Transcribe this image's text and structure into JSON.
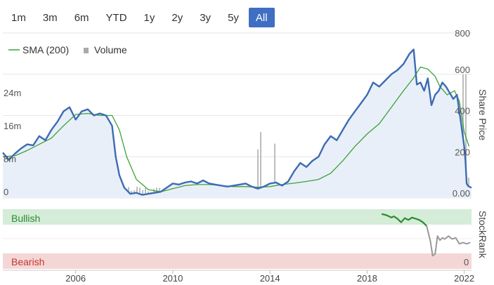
{
  "range_buttons": [
    {
      "label": "1m",
      "active": false
    },
    {
      "label": "3m",
      "active": false
    },
    {
      "label": "6m",
      "active": false
    },
    {
      "label": "YTD",
      "active": false
    },
    {
      "label": "1y",
      "active": false
    },
    {
      "label": "2y",
      "active": false
    },
    {
      "label": "3y",
      "active": false
    },
    {
      "label": "5y",
      "active": false
    },
    {
      "label": "All",
      "active": true
    }
  ],
  "legend": {
    "sma_label": "SMA (200)",
    "volume_label": "Volume"
  },
  "colors": {
    "price": "#3d6bb3",
    "price_fill": "#e9eff8",
    "sma": "#3aa23a",
    "volume": "#bdbdbd",
    "bullish_band": "#d4ecd8",
    "bearish_band": "#f5d6d6",
    "stockrank_bull": "#2e8b2e",
    "stockrank_grey": "#999999",
    "active_button": "#3e6fc2"
  },
  "chart_data": [
    {
      "type": "line",
      "name": "share-price-chart",
      "x_range": [
        2003.0,
        2022.3
      ],
      "x_ticks": [
        "2006",
        "2010",
        "2014",
        "2018",
        "2022"
      ],
      "x_tick_values": [
        2006,
        2010,
        2014,
        2018,
        2022
      ],
      "y_right_label": "Share Price",
      "y_right_ticks": [
        "800",
        "600",
        "400",
        "200",
        "0.00"
      ],
      "y_right_tick_values": [
        800,
        600,
        400,
        200,
        0
      ],
      "y_right_range": [
        0,
        800
      ],
      "y_left_ticks": [
        "24m",
        "16m",
        "8m",
        "0"
      ],
      "y_left_tick_values": [
        24,
        16,
        8,
        0
      ],
      "y_left_range": [
        0,
        40
      ],
      "series": [
        {
          "name": "SMA (200)",
          "x": [
            2003.0,
            2003.5,
            2004.0,
            2004.5,
            2005.0,
            2005.5,
            2006.0,
            2006.5,
            2007.0,
            2007.5,
            2007.8,
            2008.1,
            2008.5,
            2009.0,
            2009.5,
            2010.0,
            2010.5,
            2011.0,
            2011.5,
            2012.0,
            2012.5,
            2013.0,
            2013.5,
            2014.0,
            2014.5,
            2015.0,
            2015.5,
            2016.0,
            2016.5,
            2017.0,
            2017.5,
            2018.0,
            2018.5,
            2019.0,
            2019.5,
            2019.9,
            2020.2,
            2020.5,
            2020.8,
            2021.0,
            2021.3,
            2021.6,
            2021.8,
            2022.0,
            2022.2
          ],
          "y": [
            200,
            205,
            230,
            260,
            290,
            350,
            405,
            410,
            400,
            400,
            330,
            200,
            90,
            40,
            30,
            45,
            60,
            65,
            65,
            60,
            55,
            55,
            52,
            55,
            65,
            72,
            80,
            90,
            120,
            180,
            250,
            310,
            360,
            440,
            520,
            580,
            635,
            625,
            590,
            540,
            500,
            520,
            470,
            320,
            250
          ]
        },
        {
          "name": "Price",
          "x": [
            2003.0,
            2003.25,
            2003.5,
            2003.75,
            2004.0,
            2004.25,
            2004.5,
            2004.75,
            2005.0,
            2005.25,
            2005.5,
            2005.75,
            2006.0,
            2006.25,
            2006.5,
            2006.75,
            2007.0,
            2007.25,
            2007.5,
            2007.65,
            2007.8,
            2008.0,
            2008.25,
            2008.5,
            2008.75,
            2009.0,
            2009.25,
            2009.5,
            2009.75,
            2010.0,
            2010.25,
            2010.5,
            2010.75,
            2011.0,
            2011.25,
            2011.5,
            2011.75,
            2012.0,
            2012.25,
            2012.5,
            2012.75,
            2013.0,
            2013.25,
            2013.5,
            2013.75,
            2014.0,
            2014.25,
            2014.5,
            2014.75,
            2015.0,
            2015.25,
            2015.5,
            2015.75,
            2016.0,
            2016.25,
            2016.5,
            2016.75,
            2017.0,
            2017.25,
            2017.5,
            2017.75,
            2018.0,
            2018.25,
            2018.5,
            2018.75,
            2019.0,
            2019.25,
            2019.5,
            2019.75,
            2019.92,
            2020.05,
            2020.2,
            2020.35,
            2020.5,
            2020.65,
            2020.8,
            2020.95,
            2021.1,
            2021.25,
            2021.4,
            2021.55,
            2021.7,
            2021.85,
            2022.0,
            2022.05,
            2022.1,
            2022.15,
            2022.2,
            2022.3
          ],
          "y": [
            220,
            185,
            215,
            240,
            260,
            255,
            300,
            280,
            330,
            370,
            420,
            440,
            380,
            420,
            430,
            400,
            410,
            400,
            350,
            200,
            110,
            50,
            20,
            25,
            15,
            20,
            25,
            30,
            50,
            70,
            65,
            75,
            80,
            70,
            85,
            70,
            65,
            60,
            55,
            60,
            65,
            70,
            55,
            45,
            55,
            70,
            75,
            60,
            80,
            130,
            170,
            150,
            180,
            200,
            260,
            300,
            280,
            330,
            380,
            420,
            460,
            500,
            560,
            540,
            570,
            600,
            620,
            650,
            700,
            720,
            550,
            560,
            520,
            580,
            450,
            500,
            520,
            560,
            540,
            510,
            480,
            500,
            380,
            250,
            180,
            70,
            60,
            55,
            50
          ]
        }
      ],
      "volume_note": "grey volume bars along the bottom of the price panel, very small with occasional spikes"
    },
    {
      "type": "line",
      "name": "stockrank-chart",
      "y_label": "StockRank",
      "bands": [
        "Bullish",
        "Bearish"
      ],
      "bottom_tick": "0",
      "y_range": [
        0,
        100
      ],
      "series": [
        {
          "name": "StockRank (bullish period)",
          "x": [
            2018.6,
            2018.8,
            2019.0,
            2019.1,
            2019.25,
            2019.4,
            2019.55,
            2019.7,
            2019.85,
            2020.0,
            2020.15,
            2020.3,
            2020.45
          ],
          "y": [
            92,
            90,
            86,
            88,
            84,
            78,
            85,
            82,
            86,
            84,
            82,
            78,
            72
          ]
        },
        {
          "name": "StockRank (later period)",
          "x": [
            2020.45,
            2020.6,
            2020.7,
            2020.8,
            2020.9,
            2021.0,
            2021.1,
            2021.2,
            2021.35,
            2021.5,
            2021.65,
            2021.8,
            2021.95,
            2022.1,
            2022.25
          ],
          "y": [
            72,
            48,
            22,
            25,
            55,
            48,
            52,
            50,
            55,
            50,
            52,
            42,
            44,
            42,
            44
          ]
        }
      ]
    }
  ]
}
